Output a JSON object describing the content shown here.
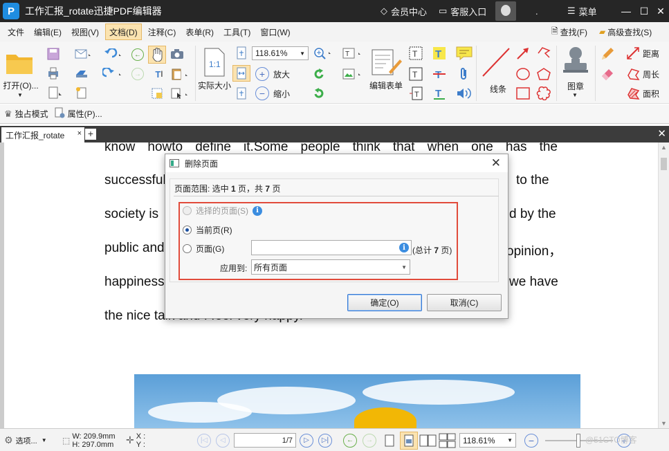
{
  "window": {
    "title": "工作汇报_rotate迅捷PDF编辑器",
    "logo": "P",
    "member_center": "会员中心",
    "support": "客服入口",
    "dot": ".",
    "menu": "菜单",
    "minimize": "—",
    "maximize": "☐",
    "close": "✕"
  },
  "menubar": {
    "items": [
      "文件",
      "编辑(E)",
      "视图(V)",
      "文档(D)",
      "注释(C)",
      "表单(R)",
      "工具(T)",
      "窗口(W)"
    ],
    "active_index": 3,
    "find": "查找(F)",
    "advanced_find": "高级查找(S)"
  },
  "ribbon": {
    "open": "打开(O)...",
    "zoom_value": "118.61%",
    "actual_size": "实际大小",
    "zoom_in": "放大",
    "zoom_out": "缩小",
    "edit_form": "编辑表单",
    "line": "线条",
    "stamp": "图章",
    "distance": "距离",
    "perimeter": "周长",
    "area": "面积",
    "actual_size_glyph": "1:1"
  },
  "quickbar": {
    "exclusive_mode": "独占模式",
    "properties": "属性(P)..."
  },
  "tabs": {
    "doc_tab": "工作汇报_rotate",
    "close": "×",
    "add": "+"
  },
  "document": {
    "lines": [
      "know  howto  define  it.Some  people  think  that  when  one  has  the",
      "successful",
      "society is",
      "public and",
      "happiness",
      "the nice talk and I feel very happy."
    ],
    "right_fragments": [
      "to  the",
      "d by the",
      "opinion，",
      "we have"
    ]
  },
  "dialog": {
    "title": "删除页面",
    "range_prefix": "页面范围: 选中",
    "range_selected": "1",
    "range_mid": "页，共",
    "range_total": "7",
    "range_suffix": "页",
    "option_selected_pages": "选择的页面(S)",
    "option_current_page": "当前页(R)",
    "option_pages": "页面(G)",
    "pages_value": "",
    "total_prefix": "(总计",
    "total_count": "7",
    "total_suffix": "页)",
    "apply_to_label": "应用到:",
    "apply_to_value": "所有页面",
    "ok": "确定(O)",
    "cancel": "取消(C)",
    "selected_option": "current_page",
    "info_glyph": "i"
  },
  "statusbar": {
    "options": "选项...",
    "width": "W: 209.9mm",
    "height": "H: 297.0mm",
    "x": "X :",
    "y": "Y :",
    "page_value": "1/7",
    "zoom_value": "118.61%"
  },
  "watermark": "@51CTO博客",
  "colors": {
    "highlight": "#e14b3b",
    "titlebar": "#262626",
    "active_menu": "#fbe3b0",
    "accent": "#3b8de0"
  }
}
